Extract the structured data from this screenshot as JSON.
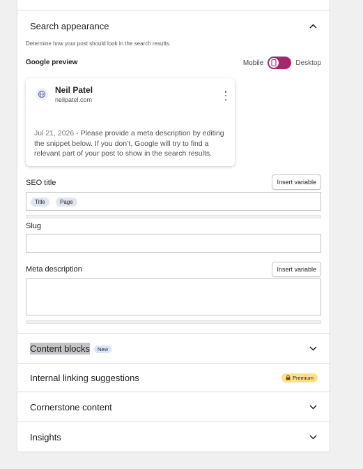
{
  "search_appearance": {
    "title": "Search appearance",
    "description": "Determine how your post should look in the search results.",
    "google_preview_label": "Google preview",
    "toggle": {
      "left_label": "Mobile",
      "right_label": "Desktop",
      "selected": "Mobile"
    },
    "preview": {
      "site_name": "Neil Patel",
      "url": "neilpatel.com",
      "date": "Jul 21, 2026",
      "separator": " - ",
      "snippet": "Please provide a meta description by editing the snippet below. If you don’t, Google will try to find a relevant part of your post to show in the search results."
    },
    "seo_title": {
      "label": "SEO title",
      "insert_button": "Insert variable",
      "tags": [
        "Title",
        "Page"
      ]
    },
    "slug": {
      "label": "Slug",
      "value": ""
    },
    "meta_description": {
      "label": "Meta description",
      "insert_button": "Insert variable",
      "value": ""
    }
  },
  "sections": {
    "content_blocks": {
      "label": "Content blocks",
      "badge": "New"
    },
    "internal_linking": {
      "label": "Internal linking suggestions",
      "badge": "Premium"
    },
    "cornerstone": {
      "label": "Cornerstone content"
    },
    "insights": {
      "label": "Insights"
    }
  },
  "icons": {
    "chevron_up": "chevron-up-icon",
    "chevron_down": "chevron-down-icon",
    "globe": "globe-icon",
    "kebab": "more-vertical-icon",
    "phone": "mobile-icon",
    "lock": "lock-icon"
  },
  "colors": {
    "accent": "#a4286a",
    "premium_badge": "#fce18a",
    "new_badge": "#d7e6ff"
  }
}
